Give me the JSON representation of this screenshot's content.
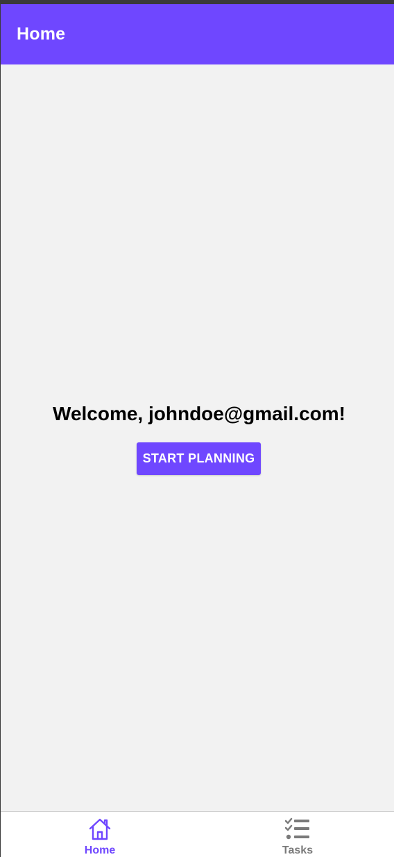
{
  "app_bar": {
    "title": "Home"
  },
  "main": {
    "welcome_text": "Welcome, johndoe@gmail.com!",
    "start_button_label": "START PLANNING"
  },
  "bottom_nav": {
    "items": [
      {
        "label": "Home",
        "icon": "home-icon",
        "active": true
      },
      {
        "label": "Tasks",
        "icon": "tasks-list-icon",
        "active": false
      }
    ]
  },
  "colors": {
    "primary": "#6f47ff",
    "background": "#f2f2f2",
    "inactive": "#7a7a7a"
  }
}
